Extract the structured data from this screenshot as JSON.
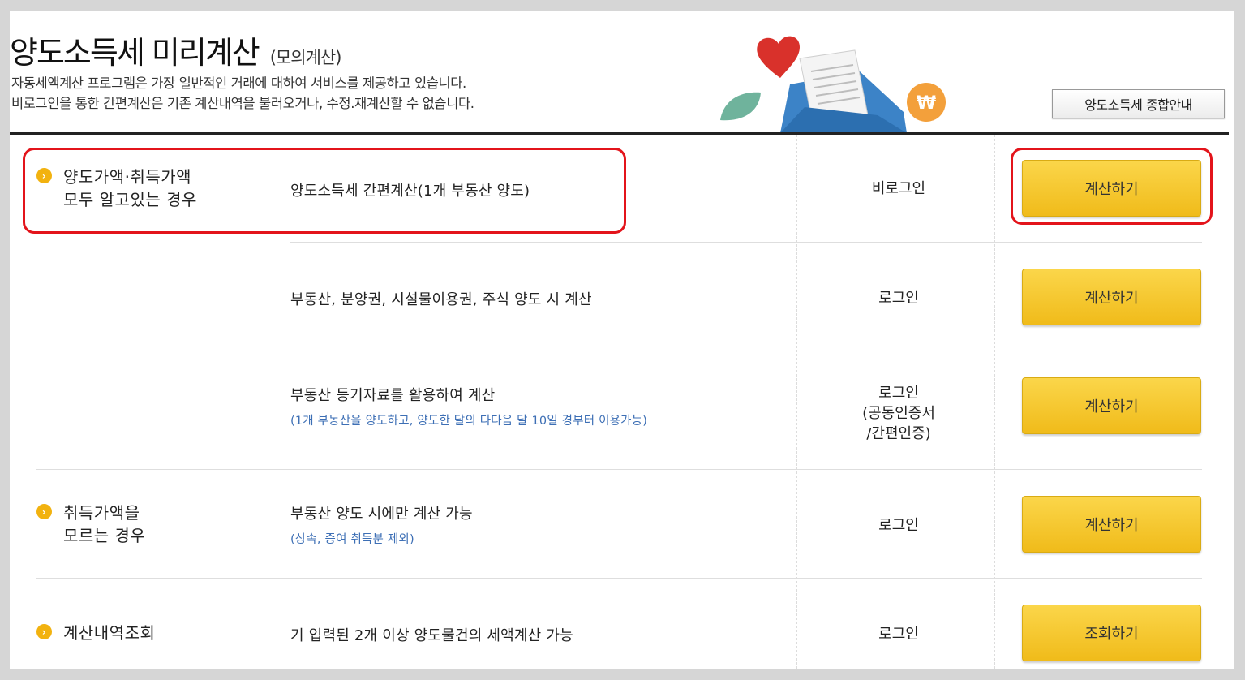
{
  "header": {
    "title": "양도소득세 미리계산",
    "subtitle": "(모의계산)",
    "intro_line1": "자동세액계산 프로그램은 가장 일반적인 거래에 대하여 서비스를 제공하고 있습니다.",
    "intro_line2": "비로그인을 통한 간편계산은 기존 계산내역을 불러오거나, 수정.재계산할 수 없습니다.",
    "guide_button": "양도소득세 종합안내"
  },
  "rows": [
    {
      "category_line1": "양도가액·취득가액",
      "category_line2": "모두 알고있는 경우",
      "desc": "양도소득세 간편계산(1개 부동산 양도)",
      "login": "비로그인",
      "button": "계산하기"
    },
    {
      "desc": "부동산, 분양권, 시설물이용권, 주식 양도 시 계산",
      "login": "로그인",
      "button": "계산하기"
    },
    {
      "desc": "부동산 등기자료를 활용하여 계산",
      "note": "(1개 부동산을 양도하고, 양도한 달의 다다음 달 10일 경부터 이용가능)",
      "login_line1": "로그인",
      "login_line2": "(공동인증서",
      "login_line3": "/간편인증)",
      "button": "계산하기"
    },
    {
      "category_line1": "취득가액을",
      "category_line2": "모르는 경우",
      "desc": "부동산 양도 시에만 계산 가능",
      "note": "(상속, 증여 취득분 제외)",
      "login": "로그인",
      "button": "계산하기"
    },
    {
      "category_line1": "계산내역조회",
      "desc": "기 입력된 2개 이상 양도물건의 세액계산 가능",
      "login": "로그인",
      "button": "조회하기"
    }
  ],
  "icons": {
    "bullet": "chevron-right-icon",
    "illustration": "envelope-heart-won-illustration"
  },
  "colors": {
    "button_yellow": "#f5c62c",
    "highlight_red": "#e3141b",
    "note_blue": "#3d6fb5",
    "bullet_orange": "#f2b20f"
  }
}
